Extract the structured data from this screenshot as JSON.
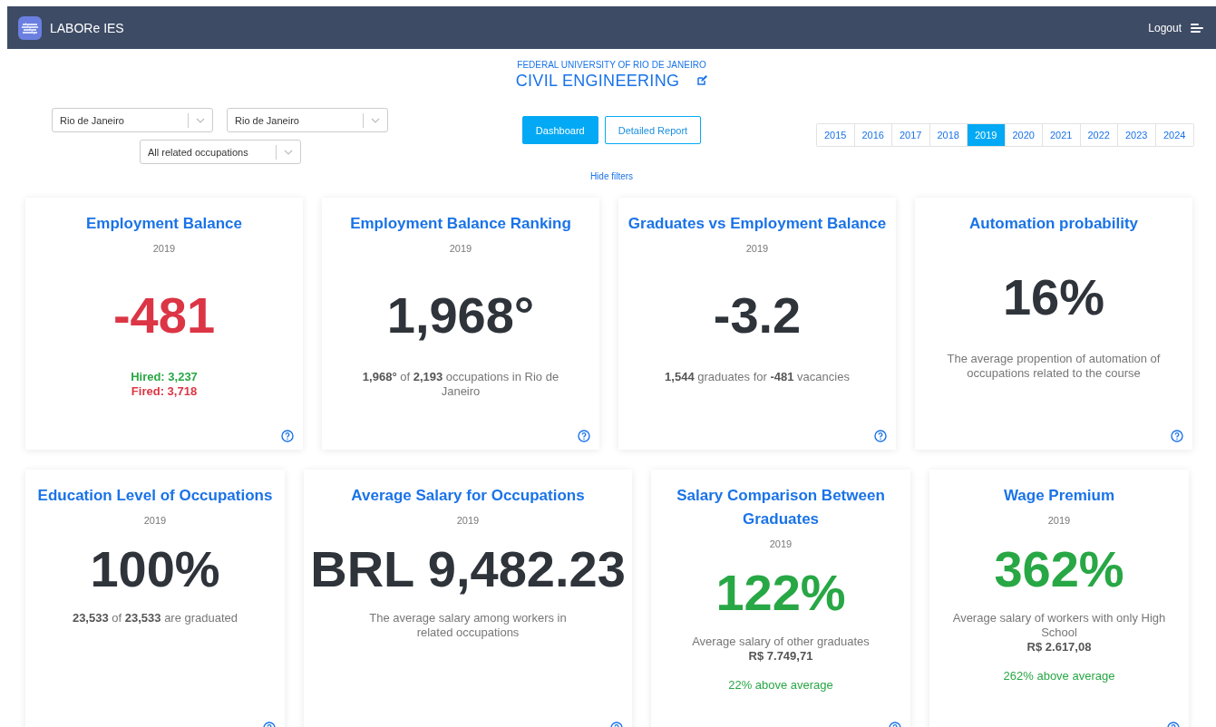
{
  "header": {
    "brand": "LABORe IES",
    "logout": "Logout"
  },
  "course": {
    "university": "FEDERAL UNIVERSITY OF RIO DE JANEIRO",
    "name": "CIVIL ENGINEERING"
  },
  "filters": [
    {
      "value": "Rio de Janeiro"
    },
    {
      "value": "Rio de Janeiro"
    },
    {
      "value": "All related occupations"
    }
  ],
  "views": [
    {
      "label": "Dashboard",
      "selected": true
    },
    {
      "label": "Detailed Report",
      "selected": false
    }
  ],
  "years": [
    {
      "label": "2015",
      "selected": false
    },
    {
      "label": "2016",
      "selected": false
    },
    {
      "label": "2017",
      "selected": false
    },
    {
      "label": "2018",
      "selected": false
    },
    {
      "label": "2019",
      "selected": true
    },
    {
      "label": "2020",
      "selected": false
    },
    {
      "label": "2021",
      "selected": false
    },
    {
      "label": "2022",
      "selected": false
    },
    {
      "label": "2023",
      "selected": false
    },
    {
      "label": "2024",
      "selected": false
    }
  ],
  "hide_filters": "Hide filters",
  "cards": [
    {
      "title": "Employment Balance",
      "year": "2019",
      "value": "-481",
      "color": "#dc3545",
      "lines": [
        {
          "text": "Hired: 3,237",
          "kind": "status",
          "color": "#28a745"
        },
        {
          "text": "Fired: 3,718",
          "kind": "status",
          "color": "#dc3545"
        }
      ]
    },
    {
      "title": "Employment Balance Ranking",
      "year": "2019",
      "value": "1,968°",
      "color": "#2f343b",
      "lines": [
        {
          "text": "**1,968°** of **2,193** occupations in Rio de Janeiro",
          "kind": "description"
        }
      ]
    },
    {
      "title": "Graduates vs Employment Balance",
      "year": "2019",
      "value": "-3.2",
      "color": "#2f343b",
      "lines": [
        {
          "text": "**1,544** graduates for **-481** vacancies",
          "kind": "description"
        }
      ]
    },
    {
      "title": "Automation probability",
      "value": "16%",
      "color": "#2f343b",
      "lines": [
        {
          "text": "The average propention of automation of occupations related to the course",
          "kind": "description"
        }
      ]
    },
    {
      "title": "Education Level of Occupations",
      "year": "2019",
      "value": "100%",
      "color": "#2f343b",
      "lines": [
        {
          "text": "**23,533** of **23,533** are graduated",
          "kind": "description"
        }
      ]
    },
    {
      "title": "Average Salary for Occupations",
      "year": "2019",
      "value": "BRL 9,482.23",
      "color": "#2f343b",
      "lines": [
        {
          "text": "The average salary among workers in related occupations",
          "kind": "description"
        }
      ]
    },
    {
      "title": "Salary Comparison Between Graduates",
      "year": "2019",
      "value": "122%",
      "color": "#28a745",
      "lines": [
        {
          "text": "Average salary of other graduates",
          "kind": "description"
        },
        {
          "text": "R$ 7.749,71",
          "kind": "amount"
        }
      ],
      "note": "22% above average"
    },
    {
      "title": "Wage Premium",
      "year": "2019",
      "value": "362%",
      "color": "#28a745",
      "lines": [
        {
          "text": "Average salary of workers with only High School",
          "kind": "description"
        },
        {
          "text": "R$ 2.617,08",
          "kind": "amount"
        }
      ],
      "note": "262% above average"
    }
  ]
}
